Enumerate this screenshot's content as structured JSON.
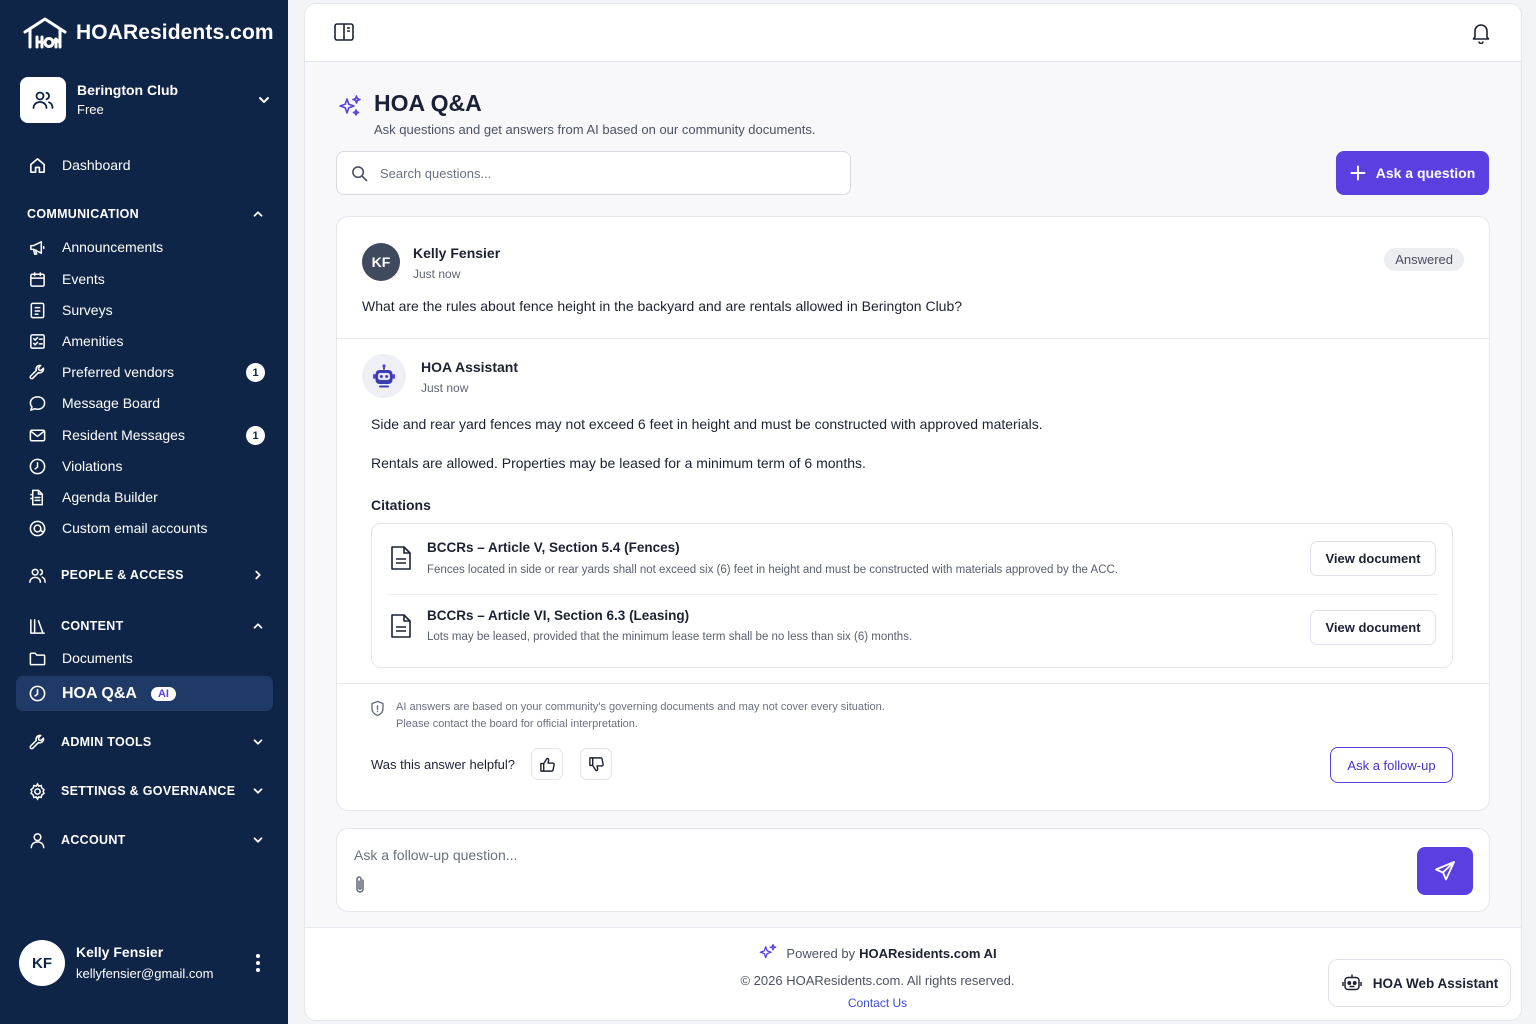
{
  "brand": {
    "name": "HOAResidents.com"
  },
  "org": {
    "name": "Berington Club",
    "plan": "Free"
  },
  "nav": {
    "dashboard": "Dashboard",
    "communication": {
      "title": "COMMUNICATION",
      "items": [
        {
          "label": "Announcements",
          "icon": "megaphone-icon"
        },
        {
          "label": "Events",
          "icon": "calendar-icon"
        },
        {
          "label": "Surveys",
          "icon": "survey-icon"
        },
        {
          "label": "Amenities",
          "icon": "amenities-icon"
        },
        {
          "label": "Preferred vendors",
          "icon": "wrench-icon",
          "badge": "1"
        },
        {
          "label": "Message Board",
          "icon": "chat-icon"
        },
        {
          "label": "Resident Messages",
          "icon": "mail-icon",
          "badge": "1"
        },
        {
          "label": "Violations",
          "icon": "alert-clock-icon"
        },
        {
          "label": "Agenda Builder",
          "icon": "agenda-icon"
        },
        {
          "label": "Custom email accounts",
          "icon": "at-icon"
        }
      ]
    },
    "people": "PEOPLE & ACCESS",
    "content": {
      "title": "CONTENT",
      "documents": "Documents",
      "qa": "HOA Q&A",
      "qa_badge": "AI"
    },
    "admin": "ADMIN TOOLS",
    "settings": "SETTINGS & GOVERNANCE",
    "account": "ACCOUNT"
  },
  "user": {
    "initials": "KF",
    "name": "Kelly Fensier",
    "email": "kellyfensier@gmail.com"
  },
  "page": {
    "title": "HOA Q&A",
    "subtitle": "Ask questions and get answers from AI based on our community documents.",
    "search_placeholder": "Search questions...",
    "ask_button": "Ask a question"
  },
  "question": {
    "initials": "KF",
    "author": "Kelly Fensier",
    "time": "Just now",
    "status": "Answered",
    "text": "What are the rules about fence height in the backyard and are rentals allowed in Berington Club?"
  },
  "answer": {
    "author": "HOA Assistant",
    "time": "Just now",
    "paragraphs": [
      "Side and rear yard fences may not exceed 6 feet in height and must be constructed with approved materials.",
      "Rentals are allowed. Properties may be leased for a minimum term of 6 months."
    ],
    "citations_heading": "Citations",
    "citations": [
      {
        "title": "BCCRs – Article V, Section 5.4 (Fences)",
        "excerpt": "Fences located in side or rear yards shall not exceed six (6) feet in height and must be constructed with materials approved by the ACC.",
        "button": "View document"
      },
      {
        "title": "BCCRs – Article VI, Section 6.3 (Leasing)",
        "excerpt": "Lots may be leased, provided that the minimum lease term shall be no less than six (6) months.",
        "button": "View document"
      }
    ],
    "disclaimer_line1": "AI answers are based on your community's governing documents and may not cover every situation.",
    "disclaimer_line2": "Please contact the board for official interpretation.",
    "helpful_prompt": "Was this answer helpful?",
    "follow_up_button": "Ask a follow-up"
  },
  "composer": {
    "placeholder": "Ask a follow-up question..."
  },
  "footer": {
    "powered_prefix": "Powered by",
    "powered_brand": "HOAResidents.com AI",
    "copyright": "© 2026 HOAResidents.com. All rights reserved.",
    "contact": "Contact Us",
    "assistant_button": "HOA Web Assistant"
  },
  "colors": {
    "sidebar": "#0f2547",
    "accent": "#5b3fe0",
    "active_item": "#1f3a66"
  }
}
